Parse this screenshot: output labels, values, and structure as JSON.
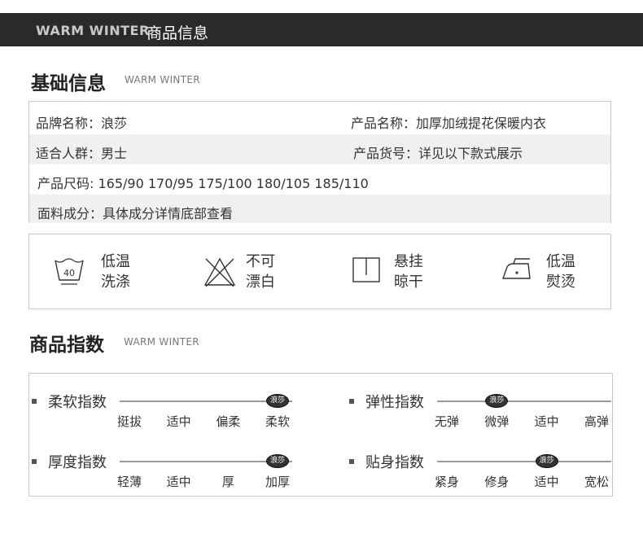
{
  "header": {
    "en": "WARM WINTER",
    "cn": "商品信息"
  },
  "basic": {
    "title": "基础信息",
    "sub": "WARM WINTER",
    "rows": [
      {
        "c1": "品牌名称：浪莎",
        "c2": "产品名称：加厚加绒提花保暖内衣"
      },
      {
        "c1": "适合人群：男士",
        "c2": "产品货号：详见以下款式展示"
      },
      {
        "c1": "产品尺码:  165/90 170/95  175/100  180/105  185/110"
      },
      {
        "c1": "面料成分：具体成分详情底部查看"
      }
    ]
  },
  "care": [
    {
      "icon": "wash-40-icon",
      "line1": "低温",
      "line2": "洗涤",
      "wash_temp": "40"
    },
    {
      "icon": "no-bleach-icon",
      "line1": "不可",
      "line2": "漂白"
    },
    {
      "icon": "hang-dry-icon",
      "line1": "悬挂",
      "line2": "晾干"
    },
    {
      "icon": "low-iron-icon",
      "line1": "低温",
      "line2": "熨烫"
    }
  ],
  "index": {
    "title": "商品指数",
    "sub": "WARM WINTER",
    "badge": "浪莎",
    "items": [
      {
        "name": "柔软指数",
        "scale": [
          "挺拔",
          "适中",
          "偏柔",
          "柔软"
        ],
        "selected": 3
      },
      {
        "name": "弹性指数",
        "scale": [
          "无弹",
          "微弹",
          "适中",
          "高弹"
        ],
        "selected": 1
      },
      {
        "name": "厚度指数",
        "scale": [
          "轻薄",
          "适中",
          "厚",
          "加厚"
        ],
        "selected": 3
      },
      {
        "name": "贴身指数",
        "scale": [
          "紧身",
          "修身",
          "适中",
          "宽松"
        ],
        "selected": 2
      }
    ]
  }
}
